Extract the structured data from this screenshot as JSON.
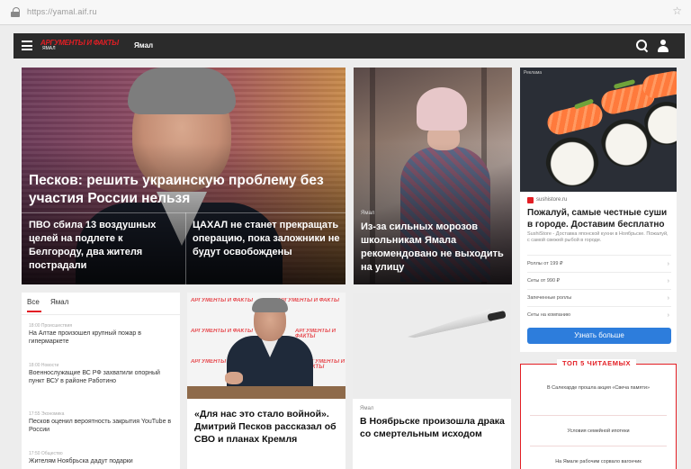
{
  "browser": {
    "url": "https://yamal.aif.ru"
  },
  "header": {
    "logo_main": "АРГУМЕНТЫ И ФАКТЫ",
    "logo_sub": "ЯМАЛ",
    "region": "Ямал"
  },
  "hero": {
    "title": "Песков: решить украинскую проблему без участия России нельзя",
    "sub_left": "ПВО сбила 13 воздушных целей на подлете к Белгороду, два жителя пострадали",
    "sub_right": "ЦАХАЛ не станет прекращать операцию, пока заложники не будут освобождены"
  },
  "girl_card": {
    "tag": "Ямал",
    "title": "Из-за сильных морозов школьникам Ямала рекомендовано не выходить на улицу"
  },
  "ad": {
    "label": "Реклама",
    "source": "sushistore.ru",
    "title": "Пожалуй, самые честные суши в городе. Доставим бесплатно",
    "desc": "SushiStore - Доставка японской кухни в Ноябрьске. Пожалуй, с самой свежей рыбой в городе.",
    "links": [
      "Роллы от 199 ₽",
      "Сеты от 990 ₽",
      "Запеченные роллы",
      "Сеты на компанию"
    ],
    "button": "Узнать больше"
  },
  "feed": {
    "tab_all": "Все",
    "tab_yamal": "Ямал",
    "items": [
      {
        "time": "18:00 Происшествия",
        "text": "На Алтае произошел крупный пожар в гипермаркете"
      },
      {
        "time": "18:00 Новости",
        "text": "Военнослужащие ВС РФ захватили опорный пункт ВСУ в районе Работино"
      },
      {
        "time": "17:55 Экономика",
        "text": "Песков оценил вероятность закрытия YouTube в России"
      },
      {
        "time": "17:50 Общество",
        "text": "Жителям Ноябрьска дадут подарки"
      }
    ]
  },
  "peskov_card": {
    "logo": "АРГУМЕНТЫ И ФАКТЫ",
    "title": "«Для нас это стало войной». Дмитрий Песков рассказал об СВО и планах Кремля"
  },
  "knife_card": {
    "tag": "Ямал",
    "title": "В Ноябрьске произошла драка со смертельным исходом"
  },
  "top5": {
    "heading": "ТОП 5 ЧИТАЕМЫХ",
    "items": [
      "В Салехарде прошла акция «Свеча памяти»",
      "Условия семейной ипотеки",
      "На Ямале рабочим сорвало вагончик"
    ]
  }
}
